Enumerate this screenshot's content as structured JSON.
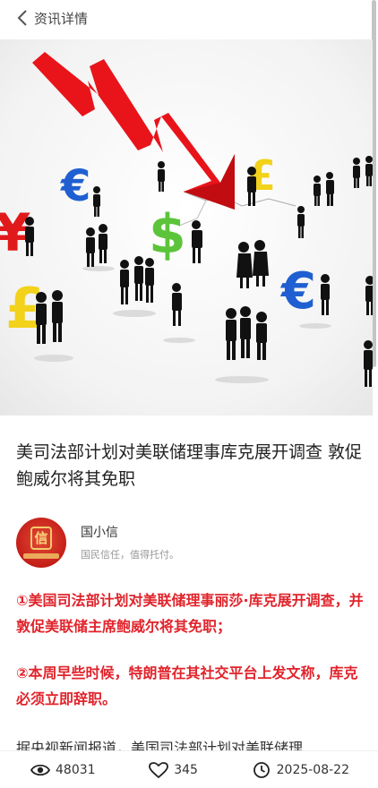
{
  "header": {
    "back_label": "资讯详情"
  },
  "article": {
    "title": "美司法部计划对美联储理事库克展开调查 敦促鲍威尔将其免职",
    "author": {
      "name": "国小信",
      "motto": "国民信任，值得托付。",
      "avatar_text": "信"
    },
    "highlights": [
      "①美国司法部计划对美联储理事丽莎·库克展开调查，并敦促美联储主席鲍威尔将其免职；",
      "②本周早些时候，特朗普在其社交平台上发文称，库克必须立即辞职。"
    ],
    "body_preview": "据央视新闻报道，美国司法部计划对美联储理"
  },
  "stats": {
    "views": "48031",
    "likes": "345",
    "date": "2025-08-22"
  },
  "hero_image": {
    "symbols": [
      "€",
      "$",
      "£",
      "¥",
      "£",
      "€"
    ],
    "arrow_color": "#e8141a",
    "euro_color": "#1f5fd1",
    "dollar_color": "#5cc43a",
    "pound_color": "#f2d21b",
    "yen_color": "#e01a1a"
  }
}
